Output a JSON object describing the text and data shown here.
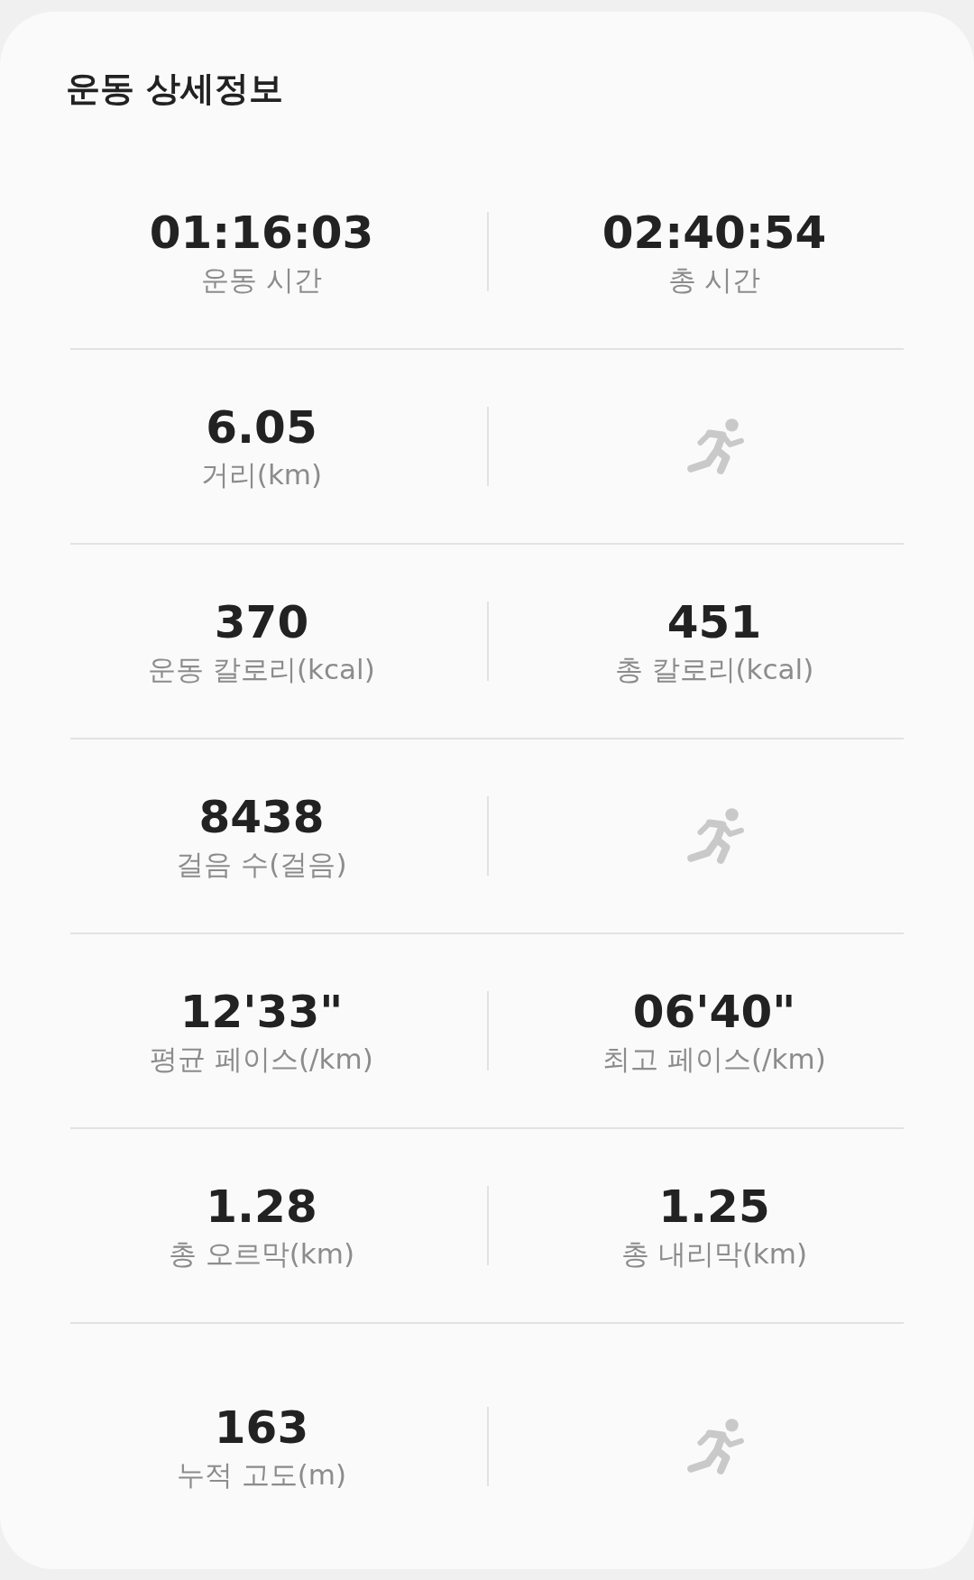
{
  "title": "운동 상세정보",
  "rows": [
    {
      "left": {
        "kind": "stat",
        "value": "01:16:03",
        "label": "운동 시간"
      },
      "right": {
        "kind": "stat",
        "value": "02:40:54",
        "label": "총 시간"
      }
    },
    {
      "left": {
        "kind": "stat",
        "value": "6.05",
        "label": "거리(km)"
      },
      "right": {
        "kind": "icon"
      }
    },
    {
      "left": {
        "kind": "stat",
        "value": "370",
        "label": "운동 칼로리(kcal)"
      },
      "right": {
        "kind": "stat",
        "value": "451",
        "label": "총 칼로리(kcal)"
      }
    },
    {
      "left": {
        "kind": "stat",
        "value": "8438",
        "label": "걸음 수(걸음)"
      },
      "right": {
        "kind": "icon"
      }
    },
    {
      "left": {
        "kind": "stat",
        "value": "12'33\"",
        "label": "평균 페이스(/km)"
      },
      "right": {
        "kind": "stat",
        "value": "06'40\"",
        "label": "최고 페이스(/km)"
      }
    },
    {
      "left": {
        "kind": "stat",
        "value": "1.28",
        "label": "총 오르막(km)"
      },
      "right": {
        "kind": "stat",
        "value": "1.25",
        "label": "총 내리막(km)"
      }
    },
    {
      "left": {
        "kind": "stat",
        "value": "163",
        "label": "누적 고도(m)"
      },
      "right": {
        "kind": "icon"
      }
    }
  ]
}
